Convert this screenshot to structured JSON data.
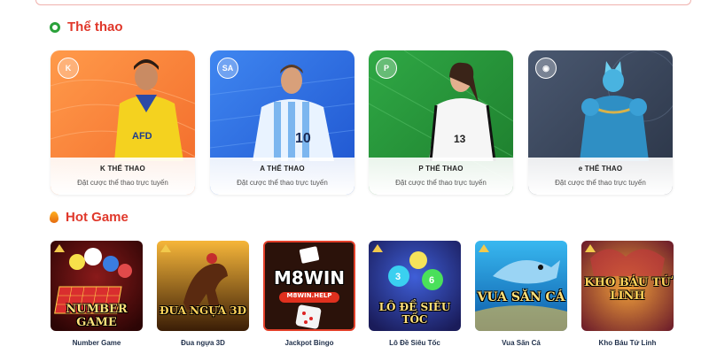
{
  "sports_section": {
    "title": "Thể thao",
    "icon": "soccer-ball-icon",
    "cards": [
      {
        "name": "K THỂ THAO",
        "description": "Đặt cược thể thao trực tuyến",
        "logo_icon": "k-sports-logo-icon",
        "theme_color": "#f58a3e"
      },
      {
        "name": "A THỂ THAO",
        "description": "Đặt cược thể thao trực tuyến",
        "logo_icon": "saba-logo-icon",
        "theme_color": "#2f6fe4"
      },
      {
        "name": "P THỂ THAO",
        "description": "Đặt cược thể thao trực tuyến",
        "logo_icon": "p-sports-logo-icon",
        "theme_color": "#2e9a3a"
      },
      {
        "name": "e THỂ THAO",
        "description": "Đặt cược thể thao trực tuyến",
        "logo_icon": "gamepad-icon",
        "theme_color": "#3c4a60"
      }
    ]
  },
  "hot_section": {
    "title": "Hot Game",
    "icon": "fire-icon",
    "games": [
      {
        "label": "Number Game",
        "art_text": "NUMBER GAME"
      },
      {
        "label": "Đua ngựa 3D",
        "art_text": "ĐUA NGỰA 3D"
      },
      {
        "label": "Jackpot Bingo",
        "art_text": "M8WIN",
        "art_subtext": "M8WIN.HELP"
      },
      {
        "label": "Lô Đề Siêu Tốc",
        "art_text": "LÔ ĐỀ SIÊU TỐC"
      },
      {
        "label": "Vua Săn Cá",
        "art_text": "VUA SĂN CÁ"
      },
      {
        "label": "Kho Báu Tứ Linh",
        "art_text": "KHO BÁU TỨ LINH"
      }
    ]
  }
}
